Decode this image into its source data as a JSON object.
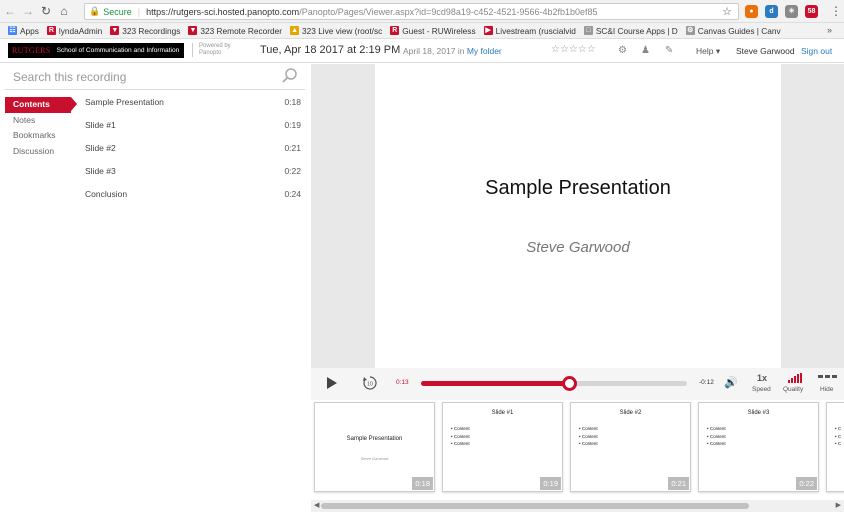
{
  "browser": {
    "secure_label": "Secure",
    "url_host": "https://rutgers-sci.hosted.panopto.com",
    "url_rest": "/Panopto/Pages/Viewer.aspx?id=9cd98a19-c452-4521-9566-4b2fb1b0ef85",
    "extensions": [
      {
        "name": "orange",
        "color": "#e8710a",
        "glyph": "●"
      },
      {
        "name": "blue",
        "color": "#2a7bc0",
        "glyph": "d"
      },
      {
        "name": "gray",
        "color": "#888888",
        "glyph": "✳"
      },
      {
        "name": "red",
        "color": "#c8102e",
        "glyph": "58"
      }
    ]
  },
  "bookmarks": [
    {
      "label": "Apps",
      "icon_color": "#4285f4",
      "icon": "☷"
    },
    {
      "label": "lyndaAdmin",
      "icon_color": "#c8102e",
      "icon": "R"
    },
    {
      "label": "323 Recordings",
      "icon_color": "#c8102e",
      "icon": "▼"
    },
    {
      "label": "323 Remote Recorder",
      "icon_color": "#c8102e",
      "icon": "▼"
    },
    {
      "label": "323 Live view (root/sc",
      "icon_color": "#e8a400",
      "icon": "▲"
    },
    {
      "label": "Guest - RUWireless",
      "icon_color": "#c8102e",
      "icon": "R"
    },
    {
      "label": "Livestream (ruscialvid",
      "icon_color": "#c8102e",
      "icon": "▶"
    },
    {
      "label": "SC&I Course Apps | D",
      "icon_color": "#999999",
      "icon": "□"
    },
    {
      "label": "Canvas Guides | Canv",
      "icon_color": "#999999",
      "icon": "⚙"
    }
  ],
  "header": {
    "logo_ru": "RUTGERS",
    "logo_text": "School of Communication and Information",
    "powered_by": "Powered by",
    "powered_brand": "Panopto",
    "title_date": "Tue, Apr 18 2017 at 2:19 PM",
    "subtitle_date": "April 18, 2017 in",
    "folder_link": "My folder",
    "rating": "☆☆☆☆☆",
    "help": "Help",
    "user": "Steve Garwood",
    "signout": "Sign out"
  },
  "sidebar": {
    "search_placeholder": "Search this recording",
    "tabs": [
      "Contents",
      "Notes",
      "Bookmarks",
      "Discussion"
    ],
    "active_tab": "Contents",
    "contents": [
      {
        "title": "Sample Presentation",
        "time": "0:18"
      },
      {
        "title": "Slide #1",
        "time": "0:19"
      },
      {
        "title": "Slide #2",
        "time": "0:21"
      },
      {
        "title": "Slide #3",
        "time": "0:22"
      },
      {
        "title": "Conclusion",
        "time": "0:24"
      }
    ]
  },
  "slide": {
    "title": "Sample Presentation",
    "author": "Steve Garwood"
  },
  "player": {
    "current_time": "0:13",
    "remaining_time": "-0:12",
    "progress_fraction": 0.555,
    "rewind_label": "10",
    "speed_value": "1x",
    "speed_label": "Speed",
    "quality_label": "Quality",
    "hide_label": "Hide"
  },
  "thumbnails": [
    {
      "title": "Sample Presentation",
      "author": "Steve Garwood",
      "bullets": [],
      "duration": "0:18"
    },
    {
      "title": "Slide #1",
      "author": "",
      "bullets": [
        "Content",
        "Content",
        "Content"
      ],
      "duration": "0:19"
    },
    {
      "title": "Slide #2",
      "author": "",
      "bullets": [
        "Content",
        "Content",
        "Content"
      ],
      "duration": "0:21"
    },
    {
      "title": "Slide #3",
      "author": "",
      "bullets": [
        "Content",
        "Content",
        "Content"
      ],
      "duration": "0:22"
    },
    {
      "title": "",
      "author": "",
      "bullets": [
        "C",
        "C",
        "C"
      ],
      "duration": ""
    }
  ],
  "colors": {
    "accent": "#c8102e",
    "link": "#2a7bc0"
  }
}
